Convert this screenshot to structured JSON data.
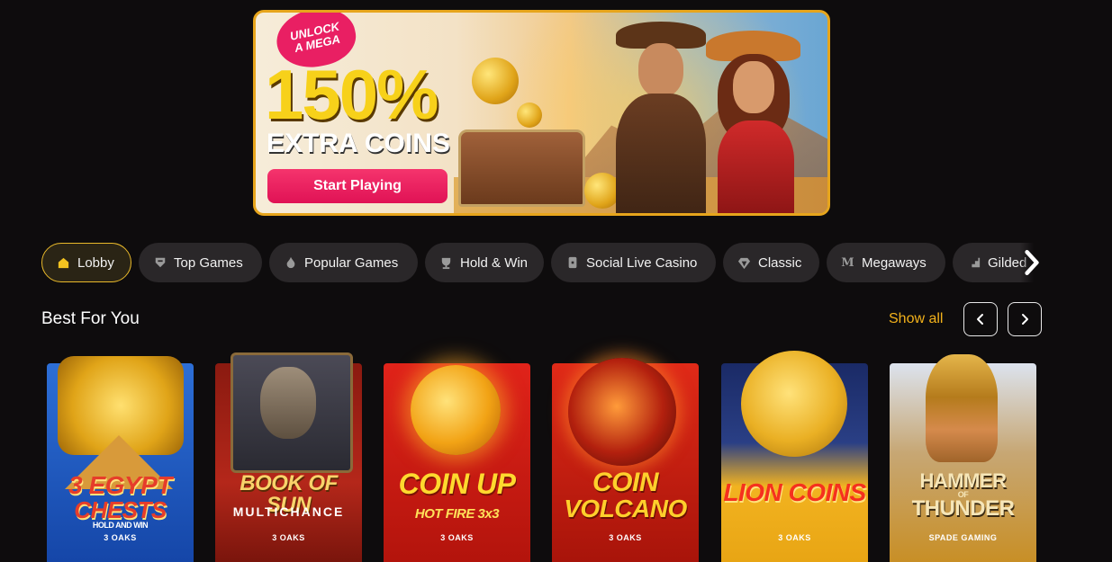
{
  "banner": {
    "badge_line1": "UNLOCK",
    "badge_line2": "A MEGA",
    "headline": "150%",
    "subline": "EXTRA COINS",
    "cta": "Start Playing"
  },
  "categories": [
    {
      "label": "Lobby",
      "icon": "home-icon",
      "active": true
    },
    {
      "label": "Top Games",
      "icon": "trophy-badge-icon",
      "active": false
    },
    {
      "label": "Popular Games",
      "icon": "flame-icon",
      "active": false
    },
    {
      "label": "Hold & Win",
      "icon": "cup-icon",
      "active": false
    },
    {
      "label": "Social Live Casino",
      "icon": "card-icon",
      "active": false
    },
    {
      "label": "Classic",
      "icon": "diamond-icon",
      "active": false
    },
    {
      "label": "Megaways",
      "icon": "m-icon",
      "active": false
    },
    {
      "label": "Gilded",
      "icon": "stairs-icon",
      "active": false
    }
  ],
  "section": {
    "title": "Best For You",
    "show_all": "Show all"
  },
  "games": [
    {
      "title_line1": "3 EGYPT",
      "title_line2": "CHESTS",
      "tagline": "HOLD AND WIN",
      "provider": "3 OAKS",
      "bg": "#1d5fc7"
    },
    {
      "title_line1": "BOOK OF SUN",
      "title_line2": "MULTICHANCE",
      "tagline": "",
      "provider": "3 OAKS",
      "bg": "#9a1b10"
    },
    {
      "title_line1": "COIN UP",
      "title_line2": "HOT FIRE 3x3",
      "tagline": "",
      "provider": "3 OAKS",
      "bg": "#c41a12"
    },
    {
      "title_line1": "COIN",
      "title_line2": "VOLCANO",
      "tagline": "",
      "provider": "3 OAKS",
      "bg": "#c3180f"
    },
    {
      "title_line1": "LION COINS",
      "title_line2": "",
      "tagline": "",
      "provider": "3 OAKS",
      "bg": "#e1a715"
    },
    {
      "title_line1": "HAMMER",
      "title_line2": "THUNDER",
      "tagline": "OF",
      "provider": "SPADE GAMING",
      "bg": "#c88f26"
    }
  ],
  "colors": {
    "accent": "#f3b21b",
    "cta": "#e91f63",
    "page_bg": "#0e0c0d",
    "chip_bg": "#2a2729"
  }
}
